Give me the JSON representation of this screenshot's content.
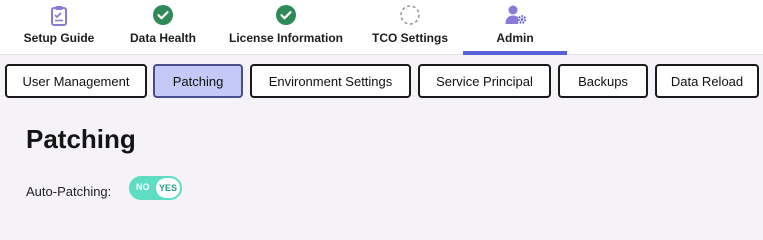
{
  "colors": {
    "accent": "#5b5fd6",
    "check_green": "#2e8b57",
    "active_subtab": "#c5c9f7",
    "toggle_on": "#5fdcc4",
    "admin_icon": "#8b7ad6"
  },
  "nav": {
    "tabs": [
      {
        "label": "Setup Guide",
        "icon": "clipboard-check-icon",
        "active": false
      },
      {
        "label": "Data Health",
        "icon": "check-circle-icon",
        "active": false
      },
      {
        "label": "License Information",
        "icon": "check-circle-icon",
        "active": false
      },
      {
        "label": "TCO Settings",
        "icon": "dashed-circle-icon",
        "active": false
      },
      {
        "label": "Admin",
        "icon": "user-gear-icon",
        "active": true
      }
    ]
  },
  "subtabs": [
    {
      "label": "User Management",
      "active": false
    },
    {
      "label": "Patching",
      "active": true
    },
    {
      "label": "Environment Settings",
      "active": false
    },
    {
      "label": "Service Principal",
      "active": false
    },
    {
      "label": "Backups",
      "active": false
    },
    {
      "label": "Data Reload",
      "active": false
    }
  ],
  "page": {
    "title": "Patching",
    "auto_patching_label": "Auto-Patching:",
    "toggle": {
      "off_label": "NO",
      "on_label": "YES",
      "value": true
    }
  }
}
